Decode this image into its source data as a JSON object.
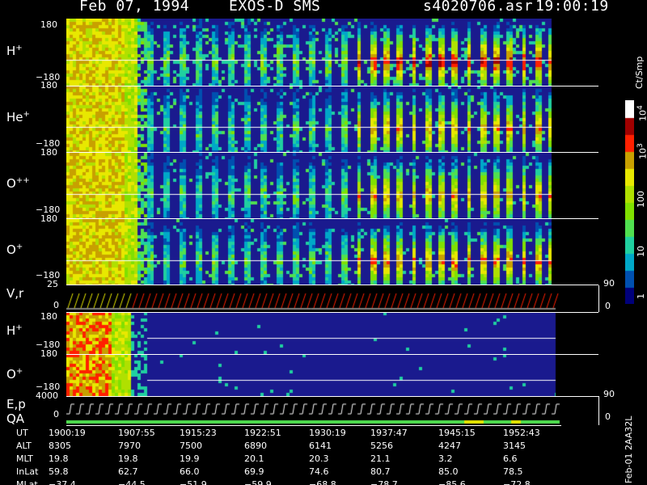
{
  "header": {
    "date": "Feb 07, 1994",
    "mission": "EXOS-D SMS",
    "file": "s4020706.asr",
    "time": "19:00:19"
  },
  "colors": {
    "background": "#1a1a8e",
    "scale": [
      "#00007a",
      "#0050b0",
      "#00a8c8",
      "#20d0a0",
      "#50e050",
      "#80e000",
      "#b0e000",
      "#e8e800",
      "#c8a000",
      "#ff2000",
      "#a00000",
      "#ffffff"
    ]
  },
  "panels": {
    "h_plus": {
      "ion": "H",
      "charge": "+",
      "ymax": "180",
      "ymin": "−180"
    },
    "he_plus": {
      "ion": "He",
      "charge": "+",
      "ymax": "180",
      "ymin": "−180"
    },
    "o_pp": {
      "ion": "O",
      "charge": "++",
      "ymax": "180",
      "ymin": "−180"
    },
    "o_plus": {
      "ion": "O",
      "charge": "+",
      "ymax": "180",
      "ymin": "−180"
    },
    "vr": {
      "label": "V,r",
      "ymax": "25",
      "ymin": "0",
      "right_max": "90",
      "right_min": "0"
    },
    "h_plus2": {
      "ion": "H",
      "charge": "+",
      "ymax": "180",
      "ymin": "−180"
    },
    "o_plus2": {
      "ion": "O",
      "charge": "+",
      "ymax": "180",
      "ymin": "−180"
    },
    "ep": {
      "label1": "E,p",
      "label2": "QA",
      "ymax": "4000",
      "ymin": "0",
      "right_max": "90",
      "right_min": "0"
    }
  },
  "colorbar": {
    "unit": "Ct/Smp",
    "labels": [
      "10",
      "10",
      "100",
      "10",
      "1"
    ],
    "exponents": [
      "4",
      "3",
      "",
      "",
      ""
    ]
  },
  "table": {
    "labels": [
      "UT",
      "ALT",
      "MLT",
      "InLat",
      "MLat"
    ],
    "columns": [
      [
        "1900:19",
        "8305",
        "19.8",
        "59.8",
        "−37.4"
      ],
      [
        "1907:55",
        "7970",
        "19.8",
        "62.7",
        "−44.5"
      ],
      [
        "1915:23",
        "7500",
        "19.9",
        "66.0",
        "−51.9"
      ],
      [
        "1922:51",
        "6890",
        "20.1",
        "69.9",
        "−59.9"
      ],
      [
        "1930:19",
        "6141",
        "20.3",
        "74.6",
        "−68.8"
      ],
      [
        "1937:47",
        "5256",
        "21.1",
        "80.7",
        "−78.7"
      ],
      [
        "1945:15",
        "4247",
        "3.2",
        "85.0",
        "−85.6"
      ],
      [
        "1952:43",
        "3145",
        "6.6",
        "78.5",
        "−72.8"
      ]
    ]
  },
  "footer_id": "Feb-01 2AA32L",
  "chart_data": {
    "type": "heatmap",
    "title": "Feb 07, 1994   EXOS-D SMS",
    "x": [
      "1900:19",
      "1907:55",
      "1915:23",
      "1922:51",
      "1930:19",
      "1937:47",
      "1945:15",
      "1952:43"
    ],
    "ylim": [
      -180,
      180
    ],
    "series": [
      {
        "name": "H+"
      },
      {
        "name": "He+"
      },
      {
        "name": "O++"
      },
      {
        "name": "O+"
      },
      {
        "name": "H+"
      },
      {
        "name": "O+"
      }
    ],
    "colorbar_ticks": [
      1,
      10,
      100,
      1000,
      10000
    ]
  }
}
